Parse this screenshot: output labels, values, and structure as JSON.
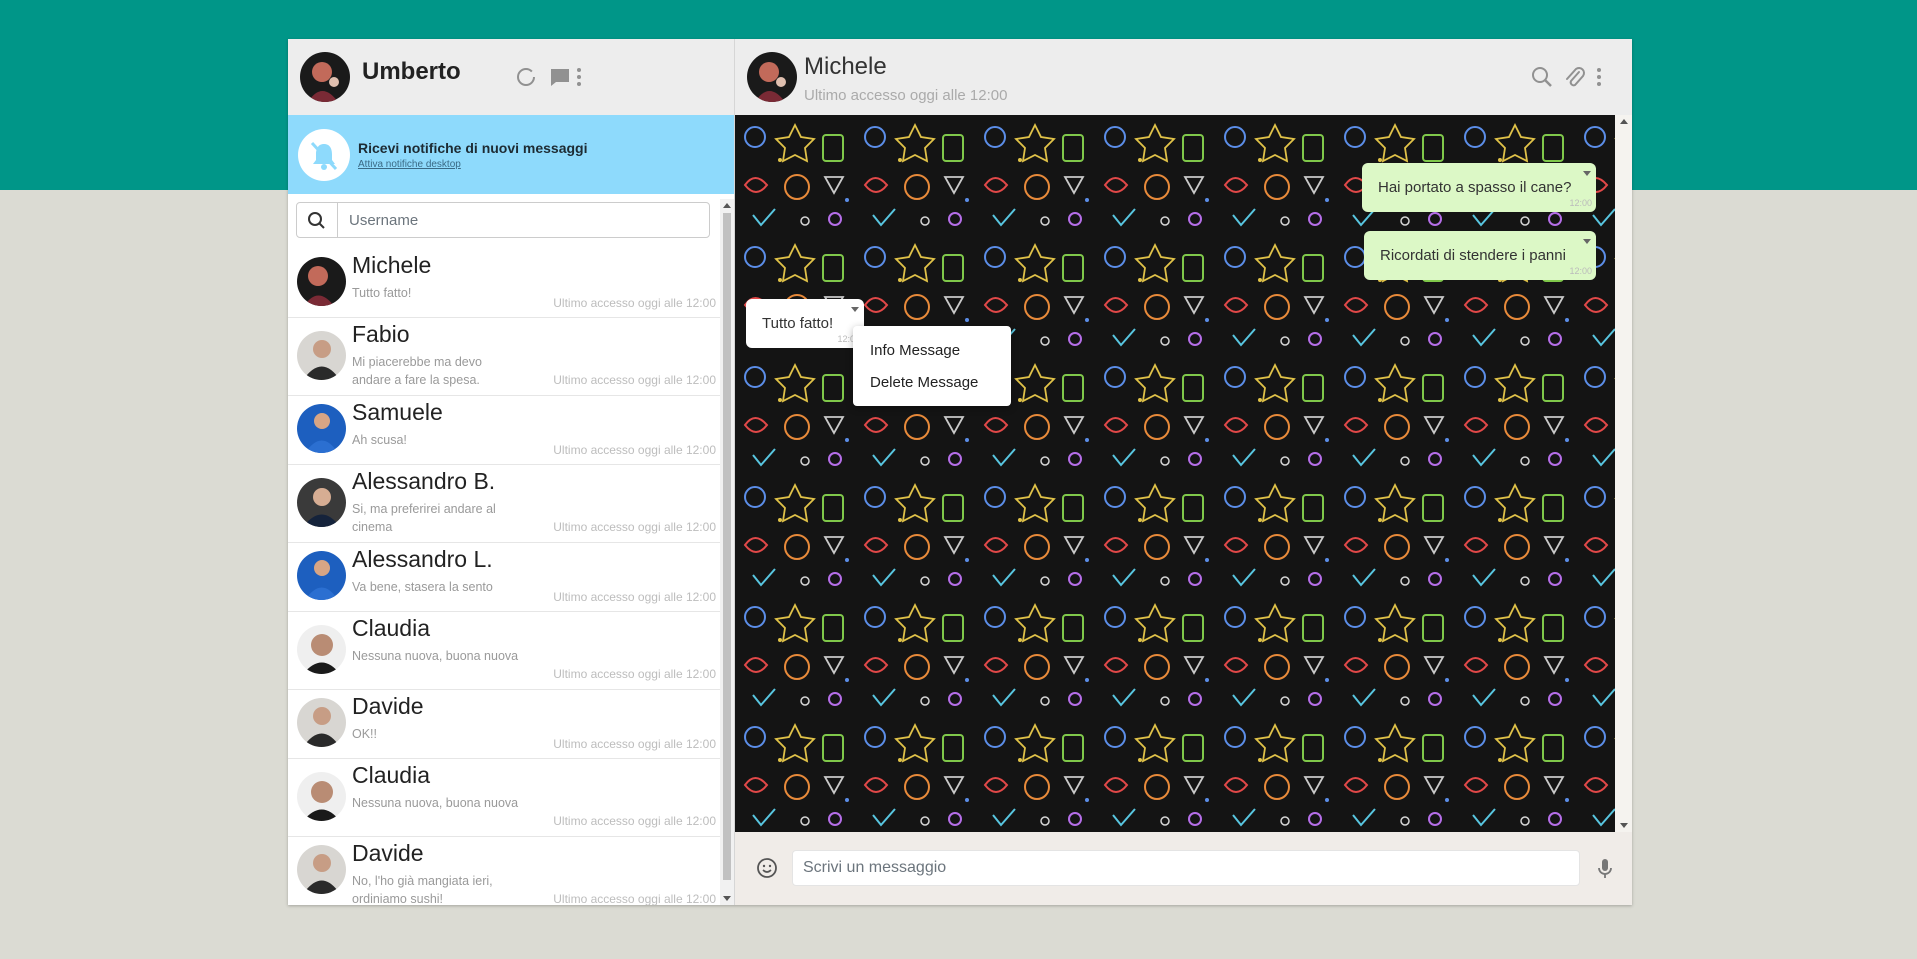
{
  "me": {
    "name": "Umberto"
  },
  "notification": {
    "title": "Ricevi notifiche di nuovi messaggi",
    "link": "Attiva notifiche desktop"
  },
  "search": {
    "placeholder": "Username"
  },
  "contacts": [
    {
      "name": "Michele",
      "last_message": "Tutto fatto!",
      "last_seen": "Ultimo accesso oggi alle 12:00"
    },
    {
      "name": "Fabio",
      "last_message": "Mi piacerebbe ma devo andare a fare la spesa.",
      "last_seen": "Ultimo accesso oggi alle 12:00"
    },
    {
      "name": "Samuele",
      "last_message": "Ah scusa!",
      "last_seen": "Ultimo accesso oggi alle 12:00"
    },
    {
      "name": "Alessandro B.",
      "last_message": "Si, ma preferirei andare al cinema",
      "last_seen": "Ultimo accesso oggi alle 12:00"
    },
    {
      "name": "Alessandro L.",
      "last_message": "Va bene, stasera la sento",
      "last_seen": "Ultimo accesso oggi alle 12:00"
    },
    {
      "name": "Claudia",
      "last_message": "Nessuna nuova, buona nuova",
      "last_seen": "Ultimo accesso oggi alle 12:00"
    },
    {
      "name": "Davide",
      "last_message": "OK!!",
      "last_seen": "Ultimo accesso oggi alle 12:00"
    },
    {
      "name": "Claudia",
      "last_message": "Nessuna nuova, buona nuova",
      "last_seen": "Ultimo accesso oggi alle 12:00"
    },
    {
      "name": "Davide",
      "last_message": "No, l'ho già mangiata ieri, ordiniamo sushi!",
      "last_seen": "Ultimo accesso oggi alle 12:00"
    }
  ],
  "chat": {
    "name": "Michele",
    "status": "Ultimo accesso oggi alle 12:00",
    "messages": [
      {
        "text": "Hai portato a spasso il cane?",
        "type": "sent",
        "time": "12:00"
      },
      {
        "text": "Ricordati di stendere i panni",
        "type": "sent",
        "time": "12:00"
      },
      {
        "text": "Tutto fatto!",
        "type": "received",
        "time": "12:00"
      }
    ],
    "context_menu": [
      "Info Message",
      "Delete Message"
    ],
    "input_placeholder": "Scrivi un messaggio"
  },
  "colors": {
    "top_band": "#009688",
    "background": "#dbdbd3",
    "header": "#ededed",
    "notification_bar": "#8edafc",
    "sent_bubble": "#dcf8c6",
    "received_bubble": "#ffffff"
  },
  "icons": {
    "left_header": [
      "status-icon",
      "chat-icon",
      "menu-icon"
    ],
    "right_header": [
      "search-icon",
      "paperclip-icon",
      "menu-icon"
    ],
    "notification": "bell-off-icon",
    "search": "search-icon",
    "footer": [
      "emoji-icon",
      "mic-icon"
    ]
  }
}
